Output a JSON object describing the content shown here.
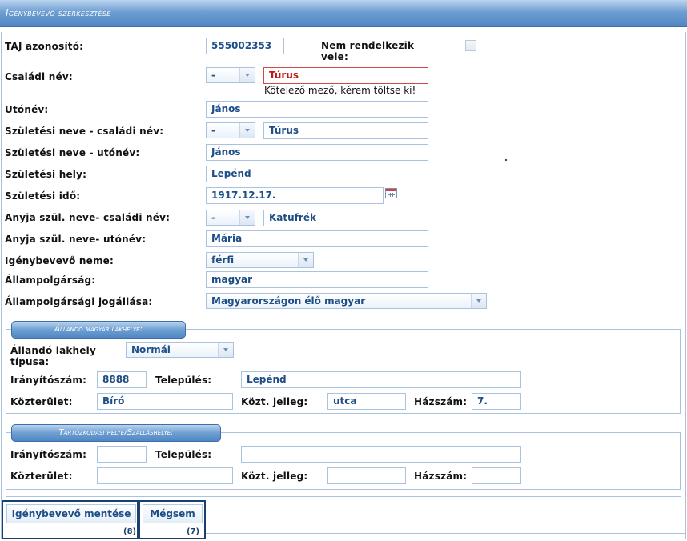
{
  "header": {
    "title": "Igénybevevő szerkesztése"
  },
  "form": {
    "taj_label": "TAJ azonosító:",
    "taj_value": "555002353",
    "no_taj_label": "Nem rendelkezik vele:",
    "family_label": "Családi név:",
    "family_prefix": "-",
    "family_value": "Túrus",
    "family_error": "Kötelező mező, kérem töltse ki!",
    "first_label": "Utónév:",
    "first_value": "János",
    "birth_family_label": "Születési neve - családi név:",
    "birth_family_prefix": "-",
    "birth_family_value": "Túrus",
    "birth_first_label": "Születési neve - utónév:",
    "birth_first_value": "János",
    "birth_place_label": "Születési hely:",
    "birth_place_value": "Lepénd",
    "birth_date_label": "Születési idő:",
    "birth_date_value": "1917.12.17.",
    "mother_family_label": "Anyja szül. neve- családi név:",
    "mother_family_prefix": "-",
    "mother_family_value": "Katufrék",
    "mother_first_label": "Anyja szül. neve- utónév:",
    "mother_first_value": "Mária",
    "gender_label": "Igénybevevő neme:",
    "gender_value": "férfi",
    "citizenship_label": "Állampolgárság:",
    "citizenship_value": "magyar",
    "citizen_status_label": "Állampolgársági jogállása:",
    "citizen_status_value": "Magyarországon élő magyar"
  },
  "permanent": {
    "legend": "Állandó magyar lakhelye:",
    "type_label": "Állandó lakhely típusa:",
    "type_value": "Normál",
    "zip_label": "Irányítószám:",
    "zip_value": "8888",
    "city_label": "Település:",
    "city_value": "Lepénd",
    "street_label": "Közterület:",
    "street_value": "Bíró",
    "street_type_label": "Közt. jelleg:",
    "street_type_value": "utca",
    "number_label": "Házszám:",
    "number_value": "7."
  },
  "temporary": {
    "legend": "Tartózkodási helye/Szálláshelye:",
    "zip_label": "Irányítószám:",
    "zip_value": "",
    "city_label": "Település:",
    "city_value": "",
    "street_label": "Közterület:",
    "street_value": "",
    "street_type_label": "Közt. jelleg:",
    "street_type_value": "",
    "number_label": "Házszám:",
    "number_value": ""
  },
  "buttons": {
    "save_label": "Igénybevevő mentése",
    "save_badge": "(8)",
    "cancel_label": "Mégsem",
    "cancel_badge": "(7)"
  }
}
